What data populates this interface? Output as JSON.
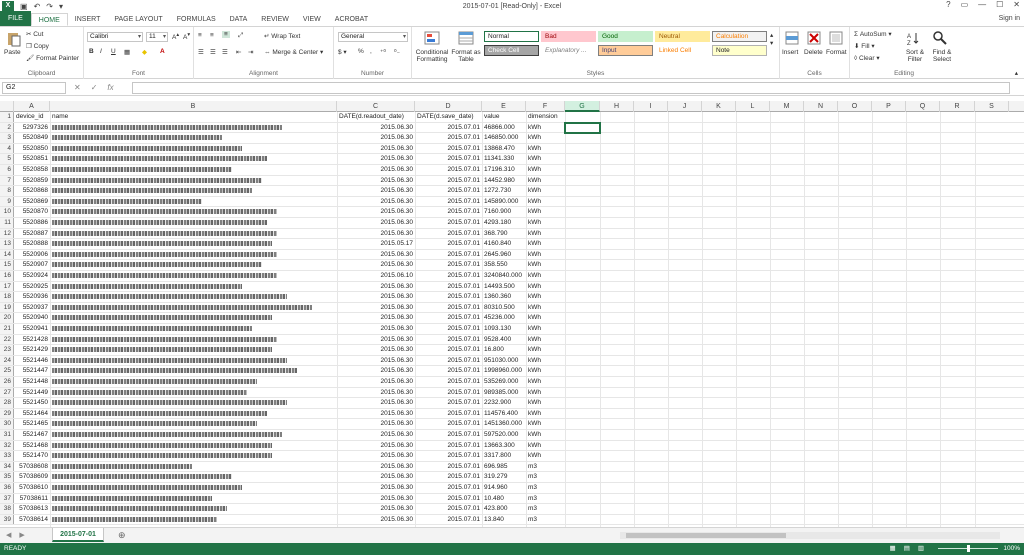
{
  "window": {
    "title": "2015-07-01  [Read-Only] - Excel",
    "app_icon": "X",
    "controls": [
      "?",
      "▭",
      "—",
      "☐",
      "✕"
    ],
    "sign_in": "Sign in"
  },
  "tabs": [
    {
      "label": "FILE"
    },
    {
      "label": "HOME"
    },
    {
      "label": "INSERT"
    },
    {
      "label": "PAGE LAYOUT"
    },
    {
      "label": "FORMULAS"
    },
    {
      "label": "DATA"
    },
    {
      "label": "REVIEW"
    },
    {
      "label": "VIEW"
    },
    {
      "label": "ACROBAT"
    }
  ],
  "ribbon": {
    "clipboard": {
      "label": "Clipboard",
      "paste": "Paste",
      "cut": "Cut",
      "copy": "Copy",
      "format_painter": "Format Painter"
    },
    "font": {
      "label": "Font",
      "name": "Calibri",
      "size": "11"
    },
    "alignment": {
      "label": "Alignment",
      "wrap_text": "Wrap Text",
      "merge_center": "Merge & Center"
    },
    "number": {
      "label": "Number",
      "format": "General",
      "percent": "%",
      "comma": ","
    },
    "styles": {
      "label": "Styles",
      "conditional": "Conditional Formatting",
      "format_table": "Format as Table",
      "cells": [
        {
          "name": "Normal",
          "bg": "#ffffff",
          "fg": "#222222",
          "border": "#217346"
        },
        {
          "name": "Bad",
          "bg": "#ffc7ce",
          "fg": "#9c0006",
          "border": "#ffc7ce"
        },
        {
          "name": "Good",
          "bg": "#c6efce",
          "fg": "#006100",
          "border": "#c6efce"
        },
        {
          "name": "Neutral",
          "bg": "#ffeb9c",
          "fg": "#9c5700",
          "border": "#ffeb9c"
        },
        {
          "name": "Calculation",
          "bg": "#f2f2f2",
          "fg": "#fa7d00",
          "border": "#7f7f7f"
        },
        {
          "name": "Check Cell",
          "bg": "#a5a5a5",
          "fg": "#ffffff",
          "border": "#3f3f3f"
        },
        {
          "name": "Explanatory ...",
          "bg": "#ffffff",
          "fg": "#7f7f7f",
          "border": "#ffffff"
        },
        {
          "name": "Input",
          "bg": "#ffcc99",
          "fg": "#3f3f76",
          "border": "#7f7f7f"
        },
        {
          "name": "Linked Cell",
          "bg": "#ffffff",
          "fg": "#fa7d00",
          "border": "#ffffff"
        },
        {
          "name": "Note",
          "bg": "#ffffcc",
          "fg": "#222222",
          "border": "#b2b2b2"
        }
      ]
    },
    "cells": {
      "label": "Cells",
      "insert": "Insert",
      "delete": "Delete",
      "format": "Format"
    },
    "editing": {
      "label": "Editing",
      "autosum": "AutoSum",
      "fill": "Fill",
      "clear": "Clear",
      "sort_filter": "Sort & Filter",
      "find_select": "Find & Select"
    }
  },
  "formula_bar": {
    "name_box": "G2",
    "fx": "fx",
    "content": ""
  },
  "grid": {
    "columns": [
      "A",
      "B",
      "C",
      "D",
      "E",
      "F",
      "G",
      "H",
      "I",
      "J",
      "K",
      "L",
      "M",
      "N",
      "O",
      "P",
      "Q",
      "R",
      "S"
    ],
    "selected_column": "G",
    "selected_cell": "G2",
    "header_row": [
      "device_id",
      "name",
      "DATE(d.readout_date)",
      "DATE(d.save_date)",
      "value",
      "dimension"
    ],
    "rows": [
      {
        "id": "5297326",
        "readout": "2015.06.30",
        "save": "2015.07.01",
        "value": "46866.000",
        "dim": "kWh",
        "w": 230
      },
      {
        "id": "5520849",
        "readout": "2015.06.30",
        "save": "2015.07.01",
        "value": "146850.000",
        "dim": "kWh",
        "w": 170
      },
      {
        "id": "5520850",
        "readout": "2015.06.30",
        "save": "2015.07.01",
        "value": "13868.470",
        "dim": "kWh",
        "w": 190
      },
      {
        "id": "5520851",
        "readout": "2015.06.30",
        "save": "2015.07.01",
        "value": "11341.330",
        "dim": "kWh",
        "w": 215
      },
      {
        "id": "5520858",
        "readout": "2015.06.30",
        "save": "2015.07.01",
        "value": "17196.310",
        "dim": "kWh",
        "w": 180
      },
      {
        "id": "5520859",
        "readout": "2015.06.30",
        "save": "2015.07.01",
        "value": "14452.980",
        "dim": "kWh",
        "w": 210
      },
      {
        "id": "5520868",
        "readout": "2015.06.30",
        "save": "2015.07.01",
        "value": "1272.730",
        "dim": "kWh",
        "w": 200
      },
      {
        "id": "5520869",
        "readout": "2015.06.30",
        "save": "2015.07.01",
        "value": "145890.000",
        "dim": "kWh",
        "w": 150
      },
      {
        "id": "5520870",
        "readout": "2015.06.30",
        "save": "2015.07.01",
        "value": "7160.900",
        "dim": "kWh",
        "w": 225
      },
      {
        "id": "5520886",
        "readout": "2015.06.30",
        "save": "2015.07.01",
        "value": "4293.180",
        "dim": "kWh",
        "w": 215
      },
      {
        "id": "5520887",
        "readout": "2015.06.30",
        "save": "2015.07.01",
        "value": "368.790",
        "dim": "kWh",
        "w": 225
      },
      {
        "id": "5520888",
        "readout": "2015.05.17",
        "save": "2015.07.01",
        "value": "4160.840",
        "dim": "kWh",
        "w": 220
      },
      {
        "id": "5520906",
        "readout": "2015.06.30",
        "save": "2015.07.01",
        "value": "2645.960",
        "dim": "kWh",
        "w": 225
      },
      {
        "id": "5520907",
        "readout": "2015.06.30",
        "save": "2015.07.01",
        "value": "358.550",
        "dim": "kWh",
        "w": 210
      },
      {
        "id": "5520924",
        "readout": "2015.06.10",
        "save": "2015.07.01",
        "value": "3240840.000",
        "dim": "kWh",
        "w": 225
      },
      {
        "id": "5520925",
        "readout": "2015.06.30",
        "save": "2015.07.01",
        "value": "14493.500",
        "dim": "kWh",
        "w": 190
      },
      {
        "id": "5520936",
        "readout": "2015.06.30",
        "save": "2015.07.01",
        "value": "1360.360",
        "dim": "kWh",
        "w": 235
      },
      {
        "id": "5520937",
        "readout": "2015.06.30",
        "save": "2015.07.01",
        "value": "80310.500",
        "dim": "kWh",
        "w": 260
      },
      {
        "id": "5520940",
        "readout": "2015.06.30",
        "save": "2015.07.01",
        "value": "45236.000",
        "dim": "kWh",
        "w": 220
      },
      {
        "id": "5520941",
        "readout": "2015.06.30",
        "save": "2015.07.01",
        "value": "1093.130",
        "dim": "kWh",
        "w": 200
      },
      {
        "id": "5521428",
        "readout": "2015.06.30",
        "save": "2015.07.01",
        "value": "9528.400",
        "dim": "kWh",
        "w": 225
      },
      {
        "id": "5521429",
        "readout": "2015.06.30",
        "save": "2015.07.01",
        "value": "16.800",
        "dim": "kWh",
        "w": 220
      },
      {
        "id": "5521446",
        "readout": "2015.06.30",
        "save": "2015.07.01",
        "value": "951030.000",
        "dim": "kWh",
        "w": 235
      },
      {
        "id": "5521447",
        "readout": "2015.06.30",
        "save": "2015.07.01",
        "value": "1998960.000",
        "dim": "kWh",
        "w": 245
      },
      {
        "id": "5521448",
        "readout": "2015.06.30",
        "save": "2015.07.01",
        "value": "535269.000",
        "dim": "kWh",
        "w": 205
      },
      {
        "id": "5521449",
        "readout": "2015.06.30",
        "save": "2015.07.01",
        "value": "989385.000",
        "dim": "kWh",
        "w": 195
      },
      {
        "id": "5521450",
        "readout": "2015.06.30",
        "save": "2015.07.01",
        "value": "2232.900",
        "dim": "kWh",
        "w": 235
      },
      {
        "id": "5521464",
        "readout": "2015.06.30",
        "save": "2015.07.01",
        "value": "114576.400",
        "dim": "kWh",
        "w": 215
      },
      {
        "id": "5521465",
        "readout": "2015.06.30",
        "save": "2015.07.01",
        "value": "1451360.000",
        "dim": "kWh",
        "w": 205
      },
      {
        "id": "5521467",
        "readout": "2015.06.30",
        "save": "2015.07.01",
        "value": "597520.000",
        "dim": "kWh",
        "w": 230
      },
      {
        "id": "5521468",
        "readout": "2015.06.30",
        "save": "2015.07.01",
        "value": "13663.300",
        "dim": "kWh",
        "w": 220
      },
      {
        "id": "5521470",
        "readout": "2015.06.30",
        "save": "2015.07.01",
        "value": "3317.800",
        "dim": "kWh",
        "w": 220
      },
      {
        "id": "57038608",
        "readout": "2015.06.30",
        "save": "2015.07.01",
        "value": "696.985",
        "dim": "m3",
        "w": 140
      },
      {
        "id": "57038609",
        "readout": "2015.06.30",
        "save": "2015.07.01",
        "value": "319.279",
        "dim": "m3",
        "w": 180
      },
      {
        "id": "57038610",
        "readout": "2015.06.30",
        "save": "2015.07.01",
        "value": "914.960",
        "dim": "m3",
        "w": 190
      },
      {
        "id": "57038611",
        "readout": "2015.06.30",
        "save": "2015.07.01",
        "value": "10.480",
        "dim": "m3",
        "w": 160
      },
      {
        "id": "57038613",
        "readout": "2015.06.30",
        "save": "2015.07.01",
        "value": "423.800",
        "dim": "m3",
        "w": 175
      },
      {
        "id": "57038614",
        "readout": "2015.06.30",
        "save": "2015.07.01",
        "value": "13.840",
        "dim": "m3",
        "w": 165
      }
    ]
  },
  "sheet_tabs": [
    {
      "label": "2015-07-01",
      "active": true
    }
  ],
  "add_sheet": "⊕",
  "status": {
    "ready": "READY",
    "zoom": "100%"
  }
}
